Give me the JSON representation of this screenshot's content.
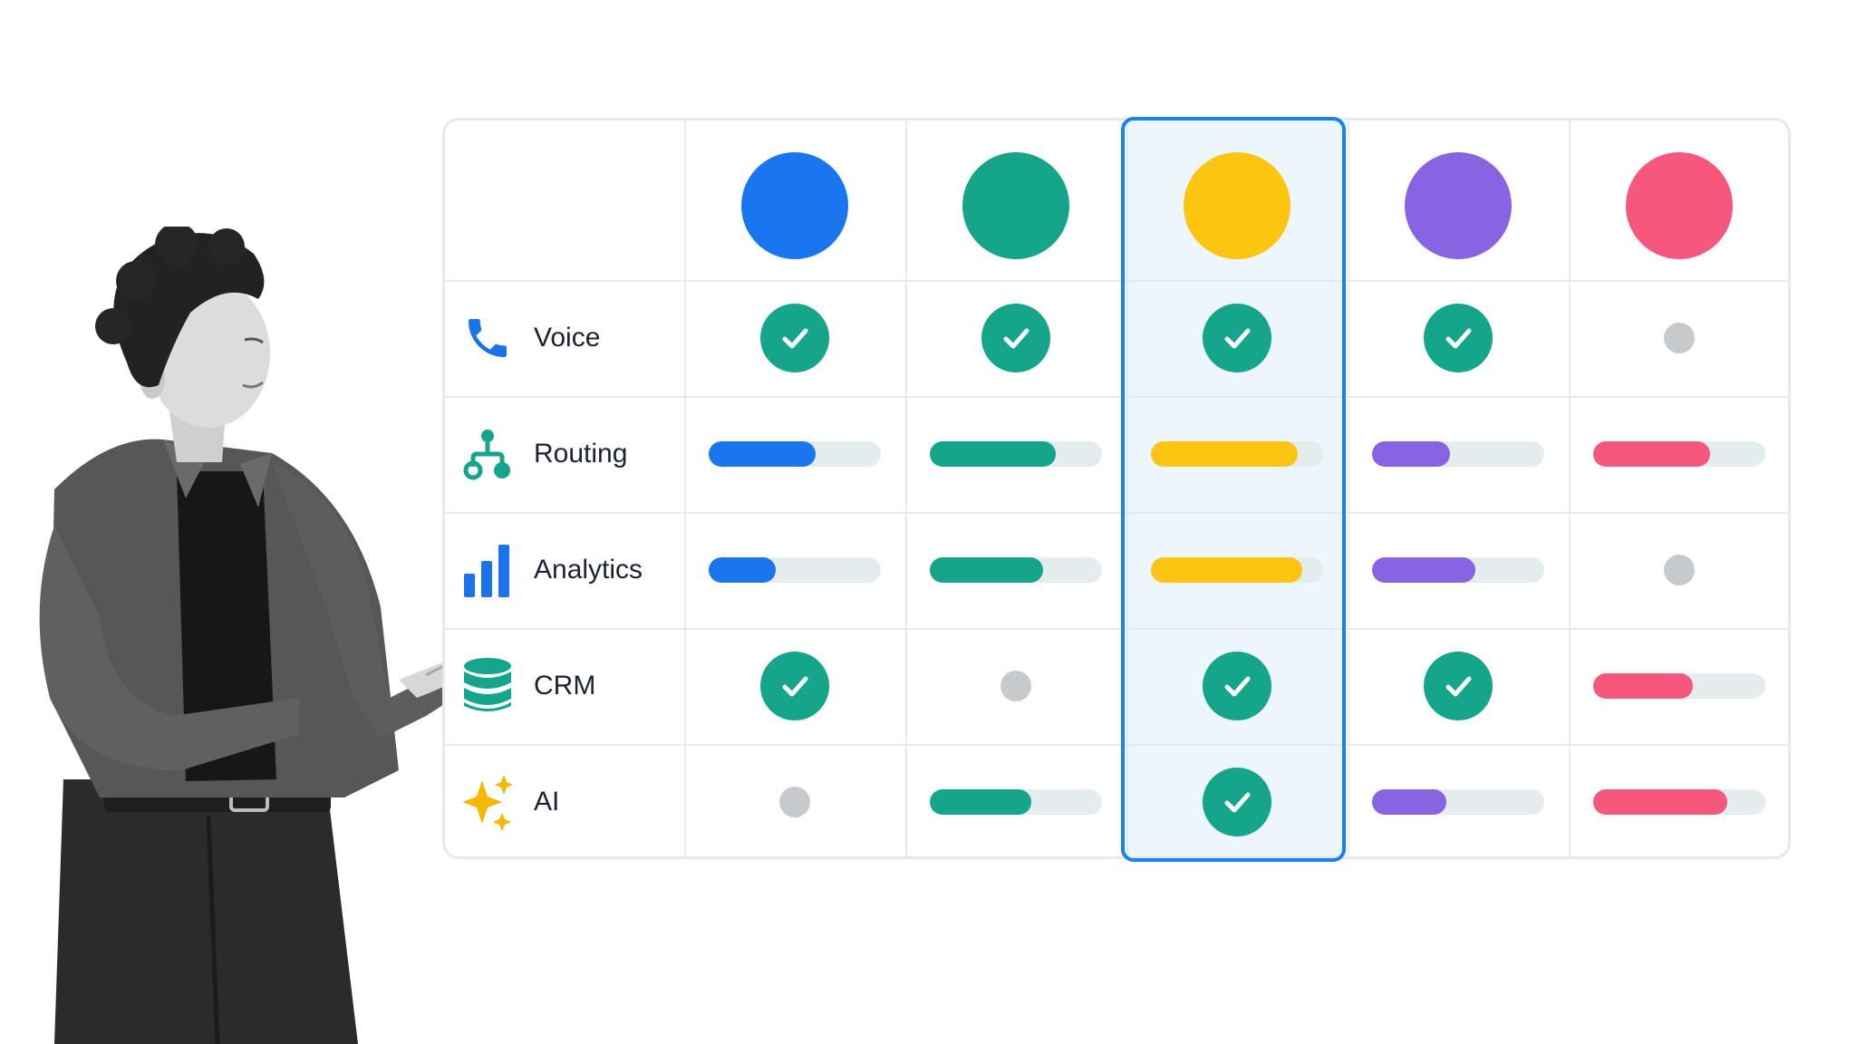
{
  "colors": {
    "blue": "#1976ee",
    "teal": "#14a58a",
    "yellow": "#fcc512",
    "purple": "#8964e2",
    "pink": "#f5577d",
    "highlight": "#1683f2",
    "unavailable": "#c7cacd"
  },
  "vendors": [
    {
      "color": "#1976ee"
    },
    {
      "color": "#14a58a"
    },
    {
      "color": "#fcc512",
      "highlighted": true
    },
    {
      "color": "#8964e2"
    },
    {
      "color": "#f5577d"
    }
  ],
  "rows": [
    {
      "label": "Voice",
      "icon": "phone-icon",
      "cells": [
        {
          "type": "check"
        },
        {
          "type": "check"
        },
        {
          "type": "check"
        },
        {
          "type": "check"
        },
        {
          "type": "none"
        }
      ]
    },
    {
      "label": "Routing",
      "icon": "routing-icon",
      "cells": [
        {
          "type": "bar",
          "level": 0.62
        },
        {
          "type": "bar",
          "level": 0.73
        },
        {
          "type": "bar",
          "level": 0.85
        },
        {
          "type": "bar",
          "level": 0.45
        },
        {
          "type": "bar",
          "level": 0.68
        }
      ]
    },
    {
      "label": "Analytics",
      "icon": "bar-chart-icon",
      "cells": [
        {
          "type": "bar",
          "level": 0.39
        },
        {
          "type": "bar",
          "level": 0.66
        },
        {
          "type": "bar",
          "level": 0.88
        },
        {
          "type": "bar",
          "level": 0.6
        },
        {
          "type": "none"
        }
      ]
    },
    {
      "label": "CRM",
      "icon": "database-icon",
      "cells": [
        {
          "type": "check"
        },
        {
          "type": "none"
        },
        {
          "type": "check"
        },
        {
          "type": "check"
        },
        {
          "type": "bar",
          "level": 0.58
        }
      ]
    },
    {
      "label": "AI",
      "icon": "sparkles-icon",
      "cells": [
        {
          "type": "none"
        },
        {
          "type": "bar",
          "level": 0.59
        },
        {
          "type": "check"
        },
        {
          "type": "bar",
          "level": 0.43
        },
        {
          "type": "bar",
          "level": 0.78
        }
      ]
    }
  ]
}
